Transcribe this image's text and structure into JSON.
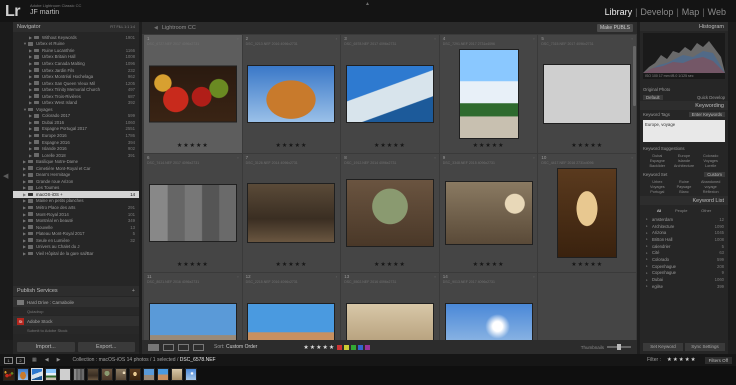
{
  "identity": {
    "logo": "Lr",
    "app": "Adobe Lightroom Classic CC",
    "user": "JF martin"
  },
  "modules": [
    "Library",
    "Develop",
    "Map",
    "Web"
  ],
  "active_module": "Library",
  "navigator": {
    "title": "Navigator",
    "zoom": "FIT  FILL  1:1  1:4"
  },
  "folders": [
    {
      "name": "Without Keywords",
      "count": "1901",
      "indent": 1
    },
    {
      "name": "Urbex et Ruine",
      "count": "",
      "indent": 0,
      "expanded": true
    },
    {
      "name": "Ruine Lucanthrie",
      "count": "1166",
      "indent": 1
    },
    {
      "name": "Urbex Britain Hall",
      "count": "1008",
      "indent": 1
    },
    {
      "name": "Urbex Canada Malting",
      "count": "1096",
      "indent": 1
    },
    {
      "name": "Urbex Jardin Fils",
      "count": "232",
      "indent": 1
    },
    {
      "name": "Urbex Montréal Hochelaga",
      "count": "962",
      "indent": 1
    },
    {
      "name": "Urbex San Queen Vieux Mil",
      "count": "1205",
      "indent": 1
    },
    {
      "name": "Urbex Trinity Memorial Church",
      "count": "497",
      "indent": 1
    },
    {
      "name": "Urbex Trois-Rivières",
      "count": "687",
      "indent": 1
    },
    {
      "name": "Urbex West Island",
      "count": "392",
      "indent": 1
    },
    {
      "name": "Voyages",
      "count": "",
      "indent": 0,
      "expanded": true
    },
    {
      "name": "Colorado 2017",
      "count": "599",
      "indent": 1
    },
    {
      "name": "Dubai 2016",
      "count": "1060",
      "indent": 1
    },
    {
      "name": "Espagne Portugal 2017",
      "count": "2551",
      "indent": 1
    },
    {
      "name": "Europe 2016",
      "count": "1786",
      "indent": 1
    },
    {
      "name": "Espagne 2016",
      "count": "394",
      "indent": 1
    },
    {
      "name": "Islande 2016",
      "count": "902",
      "indent": 1
    },
    {
      "name": "Lorelle 2018",
      "count": "391",
      "indent": 1
    },
    {
      "name": "Basilique Notre-Dame",
      "count": "",
      "indent": 0
    },
    {
      "name": "Cimetière Mont-Royal et Car",
      "count": "",
      "indent": 0
    },
    {
      "name": "Dean's Hermitage",
      "count": "",
      "indent": 0
    },
    {
      "name": "Grande roue Arizon",
      "count": "",
      "indent": 0
    },
    {
      "name": "Les Tournes",
      "count": "",
      "indent": 0
    },
    {
      "name": "macOS-iOS +",
      "count": "14",
      "indent": 0,
      "selected": true
    },
    {
      "name": "Maine en petits planches",
      "count": "",
      "indent": 0
    },
    {
      "name": "Métro Place des arts",
      "count": "291",
      "indent": 0
    },
    {
      "name": "Mont-Royal 2014",
      "count": "101",
      "indent": 0
    },
    {
      "name": "Montréal en beauté",
      "count": "349",
      "indent": 0
    },
    {
      "name": "Nouvelle",
      "count": "13",
      "indent": 0
    },
    {
      "name": "Plateau Mont-Royal 2017",
      "count": "5",
      "indent": 0
    },
    {
      "name": "Seule en Lumière",
      "count": "32",
      "indent": 0
    },
    {
      "name": "Univers au Chalet du J",
      "count": "",
      "indent": 0
    },
    {
      "name": "Vieil Hôpital de la gare sal/Bar",
      "count": "",
      "indent": 0
    }
  ],
  "publish": {
    "title": "Publish Services",
    "services": [
      {
        "name": "Hard Drive : Carnaboile",
        "sub": "Quiadrop"
      },
      {
        "name": "Adobe Stock",
        "sub": "Submit to Adobe Stock"
      }
    ]
  },
  "left_buttons": {
    "import": "Import...",
    "export": "Export..."
  },
  "center": {
    "source_title": "Lightroom CC",
    "make_publish": "Make PUBLS"
  },
  "grid": [
    {
      "num": "1",
      "meta": "DSC_6727.NEF 2017 4096x2731",
      "stars": "★★★★★",
      "thumb": "fruit",
      "w": 86,
      "h": 55,
      "selected": true
    },
    {
      "num": "2",
      "meta": "DSC_0213.NEF 2016 4096x2731",
      "stars": "★★★★★",
      "thumb": "building",
      "w": 86,
      "h": 56
    },
    {
      "num": "3",
      "meta": "DSC_6578.NEF 2017 4096x2731",
      "stars": "★★★★★",
      "thumb": "valencia",
      "w": 86,
      "h": 56
    },
    {
      "num": "4",
      "meta": "DSC_7291.NEF 2017 2731x4096",
      "stars": "★★★★★",
      "thumb": "palms",
      "w": 58,
      "h": 88
    },
    {
      "num": "5",
      "meta": "DSC_7315.NEF 2017 4096x2731",
      "stars": "★★★★★",
      "thumb": "bicycle",
      "w": 86,
      "h": 58
    },
    {
      "num": "6",
      "meta": "DSC_7414.NEF 2017 4096x2731",
      "stars": "★★★★★",
      "thumb": "facade",
      "w": 86,
      "h": 56
    },
    {
      "num": "7",
      "meta": "DSC_3126.NEF 2014 4096x2731",
      "stars": "★★★★★",
      "thumb": "ruin",
      "w": 86,
      "h": 58
    },
    {
      "num": "8",
      "meta": "DSC_1912.NEF 2014 4096x2731",
      "stars": "★★★★★",
      "thumb": "hall",
      "w": 86,
      "h": 66
    },
    {
      "num": "9",
      "meta": "DSC_3348.NEF 2015 4096x2731",
      "stars": "★★★★★",
      "thumb": "room",
      "w": 86,
      "h": 62
    },
    {
      "num": "10",
      "meta": "DSC_4417.NEF 2016 2731x4096",
      "stars": "★★★★★",
      "thumb": "church",
      "w": 58,
      "h": 88
    },
    {
      "num": "11",
      "meta": "DSC_8021.NEF 2016 4096x2731",
      "stars": "",
      "thumb": "car",
      "w": 86,
      "h": 56
    },
    {
      "num": "12",
      "meta": "DSC_2215.NEF 2016 4096x2731",
      "stars": "",
      "thumb": "desert",
      "w": 86,
      "h": 56
    },
    {
      "num": "13",
      "meta": "DSC_5502.NEF 2016 4096x2731",
      "stars": "",
      "thumb": "ceiling",
      "w": 86,
      "h": 56
    },
    {
      "num": "14",
      "meta": "DSC_9013.NEF 2017 4096x2731",
      "stars": "",
      "thumb": "sky",
      "w": 86,
      "h": 56
    },
    {
      "num": "",
      "meta": "",
      "stars": "",
      "thumb": "empty",
      "w": 0,
      "h": 0
    }
  ],
  "toolbar": {
    "sort_label": "Sort:",
    "sort_value": "Custom Order",
    "stars": "★★★★★",
    "thumb_label": "Thumbnails"
  },
  "right": {
    "histogram": "Histogram",
    "histo_info": "ISO 100   17 mm   f/8.0   1/125 sec",
    "original_photo": "Original Photo",
    "quick_develop": "Quick Develop",
    "saved_preset": "Default",
    "keywording": "Keywording",
    "keyword_tags": "Keyword Tags",
    "keyword_mode": "Enter Keywords",
    "keyword_value": "Europe, voyage",
    "keyword_suggestions": "Keyword Suggestions",
    "suggestions": [
      "Dubai",
      "Europe",
      "Colorado",
      "Espagne",
      "Islande",
      "Voyages",
      "Backlider",
      "Architecture",
      "Lorelle"
    ],
    "keyword_set": "Keyword Set",
    "keyword_set_value": "Custom",
    "set_words": [
      "Urbex",
      "Ruine",
      "Abandoned",
      "Voyages",
      "Paysage",
      "voyage",
      "Portugal",
      "Blanc",
      "Réflexion"
    ],
    "keyword_list": "Keyword List",
    "list_tabs": [
      "All",
      "People",
      "Other"
    ],
    "keywords": [
      {
        "name": "amsterdam",
        "count": "12"
      },
      {
        "name": "Architecture",
        "count": "1090"
      },
      {
        "name": "Arizona",
        "count": "1045"
      },
      {
        "name": "Britton Hall",
        "count": "1008"
      },
      {
        "name": "calendrier",
        "count": "5"
      },
      {
        "name": "Cité",
        "count": "63"
      },
      {
        "name": "Colorado",
        "count": "599"
      },
      {
        "name": "Copenhague",
        "count": "208"
      },
      {
        "name": "Copenhague",
        "count": "9"
      },
      {
        "name": "Dubai",
        "count": "1060"
      },
      {
        "name": "egilse",
        "count": "399"
      }
    ],
    "set_keyword": "Set Keyword",
    "sync_settings": "Sync Settings"
  },
  "filmstrip": {
    "primary": "1",
    "secondary": "2",
    "collection_label": "Collection : macOS-iOS",
    "count_text": "14 photos / 1 selected /",
    "filename": "DSC_6578.NEF",
    "filter_label": "Filter :",
    "filter_stars": "★★★★★",
    "filter_select": "Filters Off"
  },
  "colors": {
    "selected_cell": "#5d5d5d",
    "cell": "#454545",
    "badge": "#b3261e"
  }
}
